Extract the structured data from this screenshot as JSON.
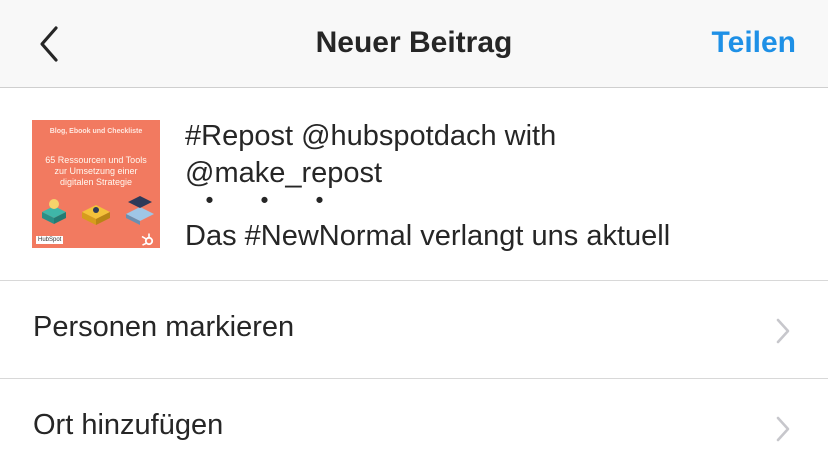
{
  "header": {
    "back_icon": "chevron-left-icon",
    "title": "Neuer Beitrag",
    "share_label": "Teilen"
  },
  "post": {
    "thumbnail": {
      "header_text": "Blog, Ebook und Checkliste",
      "title_text": "65 Ressourcen und Tools zur Umsetzung einer digitalen Strategie",
      "footer_text": "HubSpot",
      "background_color": "#f27a60"
    },
    "caption_lines": [
      "#Repost @hubspotdach with",
      "@make_repost",
      "・・・",
      "Das #NewNormal verlangt uns aktuell"
    ]
  },
  "options": [
    {
      "label": "Personen markieren",
      "icon": "chevron-right-icon"
    },
    {
      "label": "Ort hinzufügen",
      "icon": "chevron-right-icon"
    }
  ],
  "colors": {
    "accent": "#1e90e6",
    "text": "#262626",
    "navbar_bg": "#f8f8f8",
    "chevron": "#c7c7cc"
  }
}
